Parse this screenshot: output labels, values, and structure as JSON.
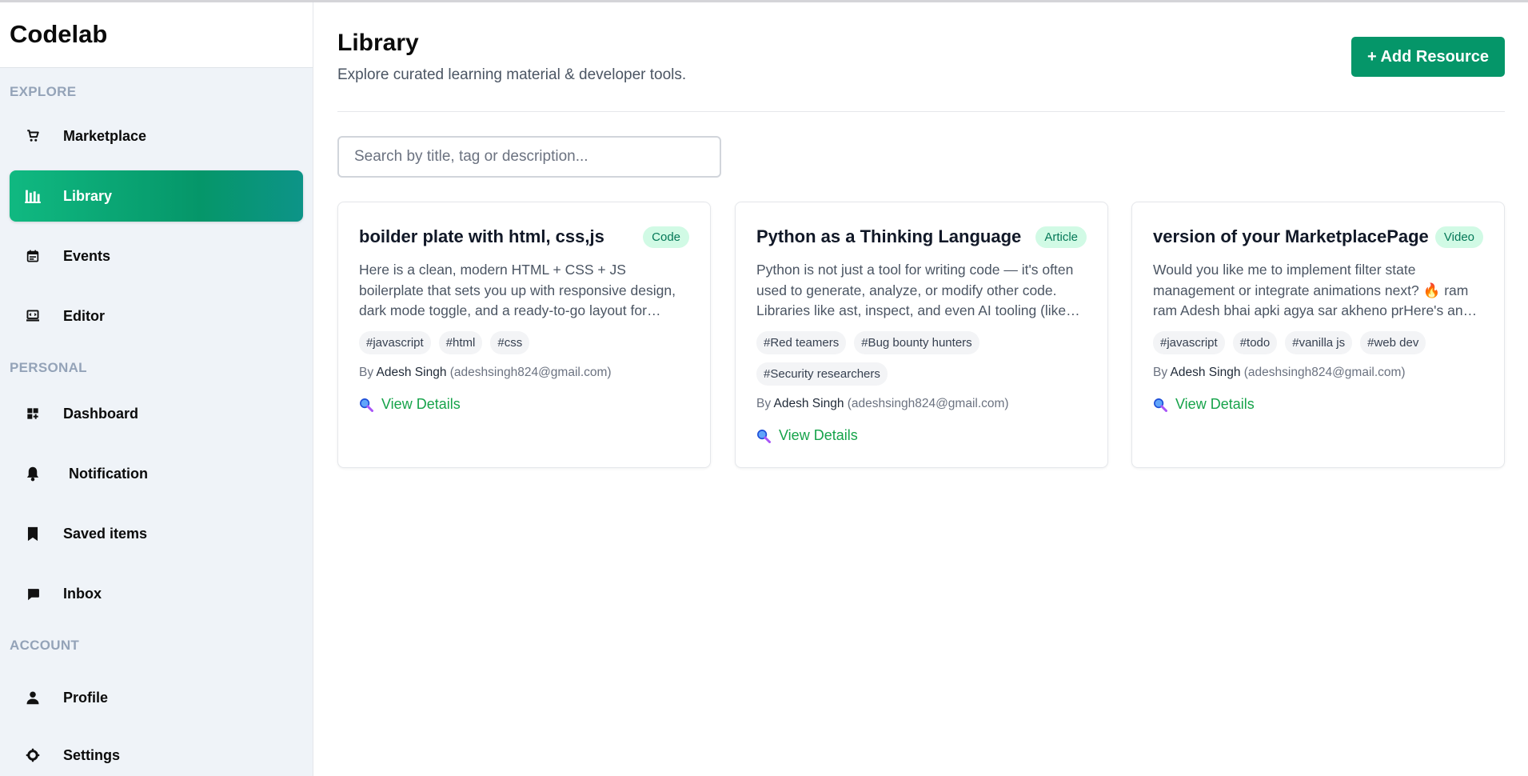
{
  "app": {
    "brand": "Codelab"
  },
  "sidebar": {
    "sections": [
      {
        "title": "EXPLORE",
        "items": [
          {
            "label": "Marketplace",
            "icon": "cart-icon"
          },
          {
            "label": "Library",
            "icon": "library-icon",
            "active": true
          },
          {
            "label": "Events",
            "icon": "calendar-icon"
          },
          {
            "label": "Editor",
            "icon": "editor-icon"
          }
        ]
      },
      {
        "title": "PERSONAL",
        "items": [
          {
            "label": "Dashboard",
            "icon": "dashboard-icon"
          },
          {
            "label": "Notification",
            "icon": "bell-icon"
          },
          {
            "label": "Saved items",
            "icon": "bookmark-icon"
          },
          {
            "label": "Inbox",
            "icon": "chat-icon"
          }
        ]
      },
      {
        "title": "ACCOUNT",
        "items": [
          {
            "label": "Profile",
            "icon": "user-icon"
          },
          {
            "label": "Settings",
            "icon": "gear-icon"
          }
        ]
      }
    ]
  },
  "header": {
    "title": "Library",
    "subtitle": "Explore curated learning material & developer tools.",
    "add_button": "+ Add Resource"
  },
  "search": {
    "placeholder": "Search by title, tag or description...",
    "value": ""
  },
  "cards": [
    {
      "title": "boilder plate with html, css,js",
      "badge": "Code",
      "description": "Here is a clean, modern HTML + CSS + JS boilerplate that sets you up with responsive design, dark mode toggle, and a ready-to-go layout for…",
      "tags": [
        "#javascript",
        "#html",
        "#css"
      ],
      "author_prefix": "By",
      "author_name": "Adesh Singh",
      "author_email": "(adeshsingh824@gmail.com)",
      "link": "View Details"
    },
    {
      "title": "Python as a Thinking Language",
      "badge": "Article",
      "description": "Python is not just a tool for writing code — it's often used to generate, analyze, or modify other code. Libraries like ast, inspect, and even AI tooling (like…",
      "tags": [
        "#Red teamers",
        "#Bug bounty hunters",
        "#Security researchers"
      ],
      "author_prefix": "By",
      "author_name": "Adesh Singh",
      "author_email": "(adeshsingh824@gmail.com)",
      "link": "View Details"
    },
    {
      "title": "version of your MarketplacePage",
      "badge": "Video",
      "description": "Would you like me to implement filter state management or integrate animations next? 🔥 ram ram Adesh bhai apki agya sar akheno prHere's an…",
      "tags": [
        "#javascript",
        "#todo",
        "#vanilla js",
        "#web dev"
      ],
      "author_prefix": "By",
      "author_name": "Adesh Singh",
      "author_email": "(adeshsingh824@gmail.com)",
      "link": "View Details"
    }
  ],
  "colors": {
    "accent": "#059669",
    "badge_bg": "#d1fae5",
    "link": "#16a34a"
  }
}
